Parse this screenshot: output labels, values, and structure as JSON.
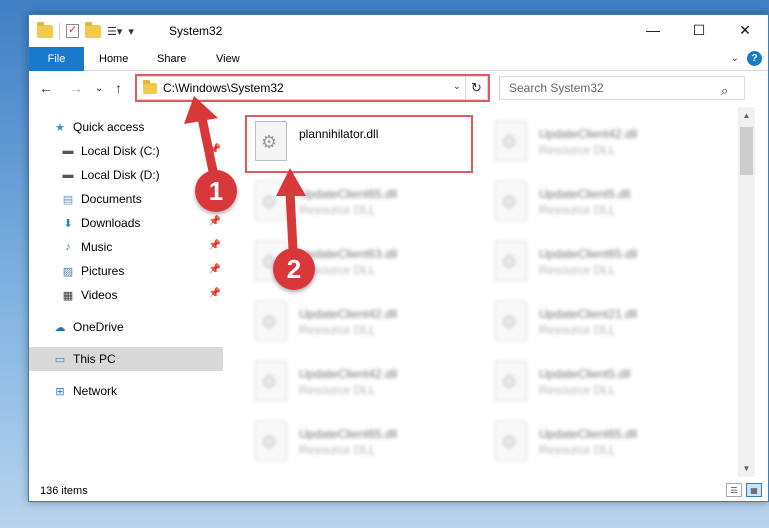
{
  "window": {
    "title": "System32"
  },
  "ribbon": {
    "tabs": [
      "File",
      "Home",
      "Share",
      "View"
    ]
  },
  "window_controls": {
    "minimize": "—",
    "maximize": "☐",
    "close": "✕"
  },
  "address_bar": {
    "path": "C:\\Windows\\System32"
  },
  "search": {
    "placeholder": "Search System32"
  },
  "sidebar": {
    "items": [
      {
        "label": "Quick access",
        "icon": "star-icon",
        "pinned": false
      },
      {
        "label": "Local Disk (C:)",
        "icon": "drive-icon",
        "pinned": true
      },
      {
        "label": "Local Disk (D:)",
        "icon": "drive-icon",
        "pinned": false
      },
      {
        "label": "Documents",
        "icon": "documents-icon",
        "pinned": true
      },
      {
        "label": "Downloads",
        "icon": "download-icon",
        "pinned": true
      },
      {
        "label": "Music",
        "icon": "music-icon",
        "pinned": true
      },
      {
        "label": "Pictures",
        "icon": "pictures-icon",
        "pinned": true
      },
      {
        "label": "Videos",
        "icon": "videos-icon",
        "pinned": true
      },
      {
        "label": "OneDrive",
        "icon": "cloud-icon",
        "pinned": false
      },
      {
        "label": "This PC",
        "icon": "computer-icon",
        "pinned": false,
        "selected": true
      },
      {
        "label": "Network",
        "icon": "network-icon",
        "pinned": false
      }
    ]
  },
  "files": [
    {
      "name": "plannihilator.dll",
      "type": ""
    },
    {
      "name": "UpdateClient42.dll",
      "type": "Resource DLL"
    },
    {
      "name": "UpdateClient65.dll",
      "type": "Resource DLL"
    },
    {
      "name": "UpdateClient5.dll",
      "type": "Resource DLL"
    },
    {
      "name": "UpdateClient63.dll",
      "type": "Resource DLL"
    },
    {
      "name": "UpdateClient65.dll",
      "type": "Resource DLL"
    },
    {
      "name": "UpdateClient42.dll",
      "type": "Resource DLL"
    },
    {
      "name": "UpdateClient21.dll",
      "type": "Resource DLL"
    },
    {
      "name": "UpdateClient42.dll",
      "type": "Resource DLL"
    },
    {
      "name": "UpdateClient5.dll",
      "type": "Resource DLL"
    },
    {
      "name": "UpdateClient65.dll",
      "type": "Resource DLL"
    },
    {
      "name": "UpdateClient65.dll",
      "type": "Resource DLL"
    }
  ],
  "status": {
    "item_count": "136 items"
  },
  "annotations": {
    "step1": "1",
    "step2": "2",
    "color": "#d9383a"
  }
}
